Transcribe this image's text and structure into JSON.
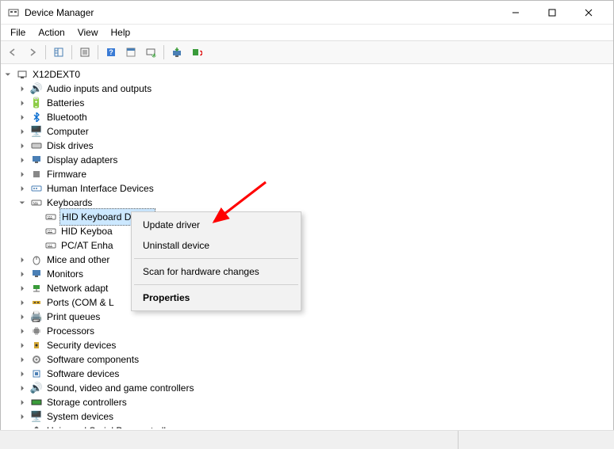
{
  "window": {
    "title": "Device Manager"
  },
  "menu": {
    "file": "File",
    "action": "Action",
    "view": "View",
    "help": "Help"
  },
  "tree": {
    "root": "X12DEXT0",
    "audio": "Audio inputs and outputs",
    "batteries": "Batteries",
    "bluetooth": "Bluetooth",
    "computer": "Computer",
    "disk": "Disk drives",
    "display": "Display adapters",
    "firmware": "Firmware",
    "hid": "Human Interface Devices",
    "keyboards": "Keyboards",
    "kbd1": "HID Keyboard Device",
    "kbd2": "HID Keyboa",
    "kbd3": "PC/AT Enha",
    "mice": "Mice and other",
    "monitors": "Monitors",
    "network": "Network adapt",
    "ports": "Ports (COM & L",
    "printqueues": "Print queues",
    "processors": "Processors",
    "security": "Security devices",
    "swcomp": "Software components",
    "swdev": "Software devices",
    "sound": "Sound, video and game controllers",
    "storage": "Storage controllers",
    "system": "System devices",
    "usb": "Universal Serial Bus controllers"
  },
  "contextMenu": {
    "update": "Update driver",
    "uninstall": "Uninstall device",
    "scan": "Scan for hardware changes",
    "properties": "Properties"
  }
}
